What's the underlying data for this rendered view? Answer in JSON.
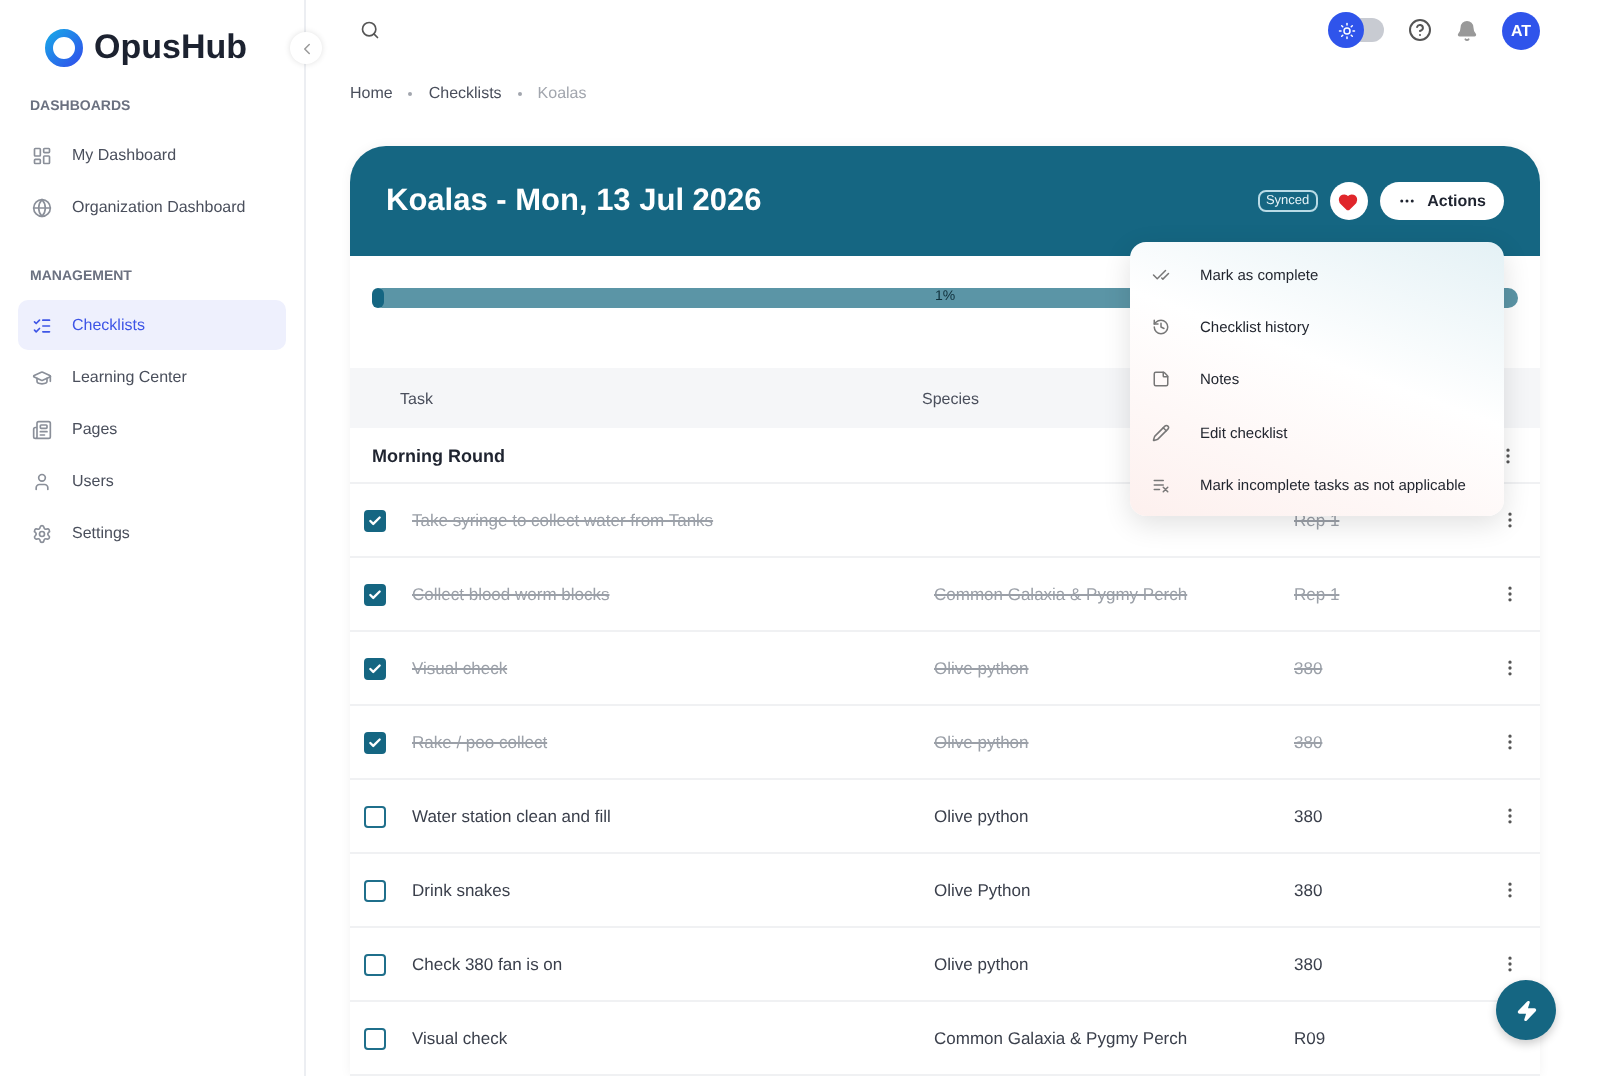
{
  "brand": "OpusHub",
  "sidebar": {
    "sections": [
      {
        "title": "DASHBOARDS",
        "items": [
          {
            "label": "My Dashboard",
            "selected": false
          },
          {
            "label": "Organization Dashboard",
            "selected": false
          }
        ]
      },
      {
        "title": "MANAGEMENT",
        "items": [
          {
            "label": "Checklists",
            "selected": true
          },
          {
            "label": "Learning Center",
            "selected": false
          },
          {
            "label": "Pages",
            "selected": false
          },
          {
            "label": "Users",
            "selected": false
          },
          {
            "label": "Settings",
            "selected": false
          }
        ]
      }
    ]
  },
  "topbar": {
    "theme_toggle": {
      "on": false
    },
    "avatar": "AT"
  },
  "breadcrumb": [
    {
      "label": "Home",
      "current": false
    },
    {
      "label": "Checklists",
      "current": false
    },
    {
      "label": "Koalas",
      "current": true
    }
  ],
  "checklist": {
    "title": "Koalas - Mon, 13 Jul 2026",
    "status_badge": "Synced",
    "favorite": true,
    "actions_button": "Actions",
    "progress": {
      "level": 0.01,
      "reading": "1%"
    }
  },
  "actions_menu": [
    {
      "label": "Mark as complete"
    },
    {
      "label": "Checklist history"
    },
    {
      "label": "Notes"
    },
    {
      "label": "Edit checklist"
    },
    {
      "label": "Mark incomplete tasks as not applicable"
    }
  ],
  "table": {
    "columns": [
      "Task",
      "Species"
    ],
    "group": "Morning Round",
    "rows": [
      {
        "task": "Take syringe to collect water from Tanks",
        "column_3": "Rep 1",
        "checked": true
      },
      {
        "task": "Collect blood worm blocks",
        "species": "Common Galaxia & Pygmy Perch",
        "column_3": "Rep 1",
        "checked": true
      },
      {
        "task": "Visual check",
        "species": "Olive python",
        "column_3": "380",
        "checked": true
      },
      {
        "task": "Rake / poo collect",
        "species": "Olive python",
        "column_3": "380",
        "checked": true
      },
      {
        "task": "Water station clean and fill",
        "species": "Olive python",
        "column_3": "380",
        "checked": false
      },
      {
        "task": "Drink snakes",
        "species": "Olive Python",
        "column_3": "380",
        "checked": false
      },
      {
        "task": "Check 380 fan is on",
        "species": "Olive python",
        "column_3": "380",
        "checked": false
      },
      {
        "task": "Visual check",
        "species": "Common Galaxia & Pygmy Perch",
        "column_3": "R09",
        "checked": false
      }
    ]
  }
}
